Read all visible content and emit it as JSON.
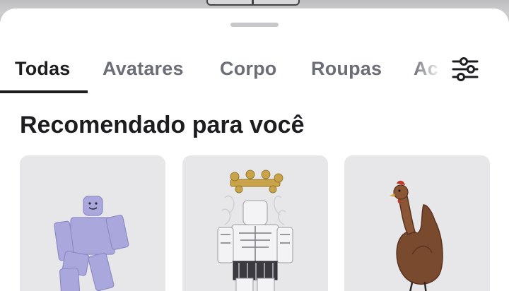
{
  "tabs": [
    {
      "label": "Todas",
      "active": true
    },
    {
      "label": "Avatares",
      "active": false
    },
    {
      "label": "Corpo",
      "active": false
    },
    {
      "label": "Roupas",
      "active": false
    },
    {
      "label": "Ac",
      "active": false
    }
  ],
  "filter": {
    "icon": "sliders-icon"
  },
  "section": {
    "title": "Recomendado para você"
  },
  "items": [
    {
      "icon": "lavender-avatar-figure"
    },
    {
      "icon": "armored-warrior-figure"
    },
    {
      "icon": "chicken-figure"
    }
  ],
  "colors": {
    "active_tab": "#1d1d1f",
    "inactive_tab": "#6b6e76",
    "card_bg": "#e7e7ea",
    "avatar_body": "#a9a7dc"
  }
}
